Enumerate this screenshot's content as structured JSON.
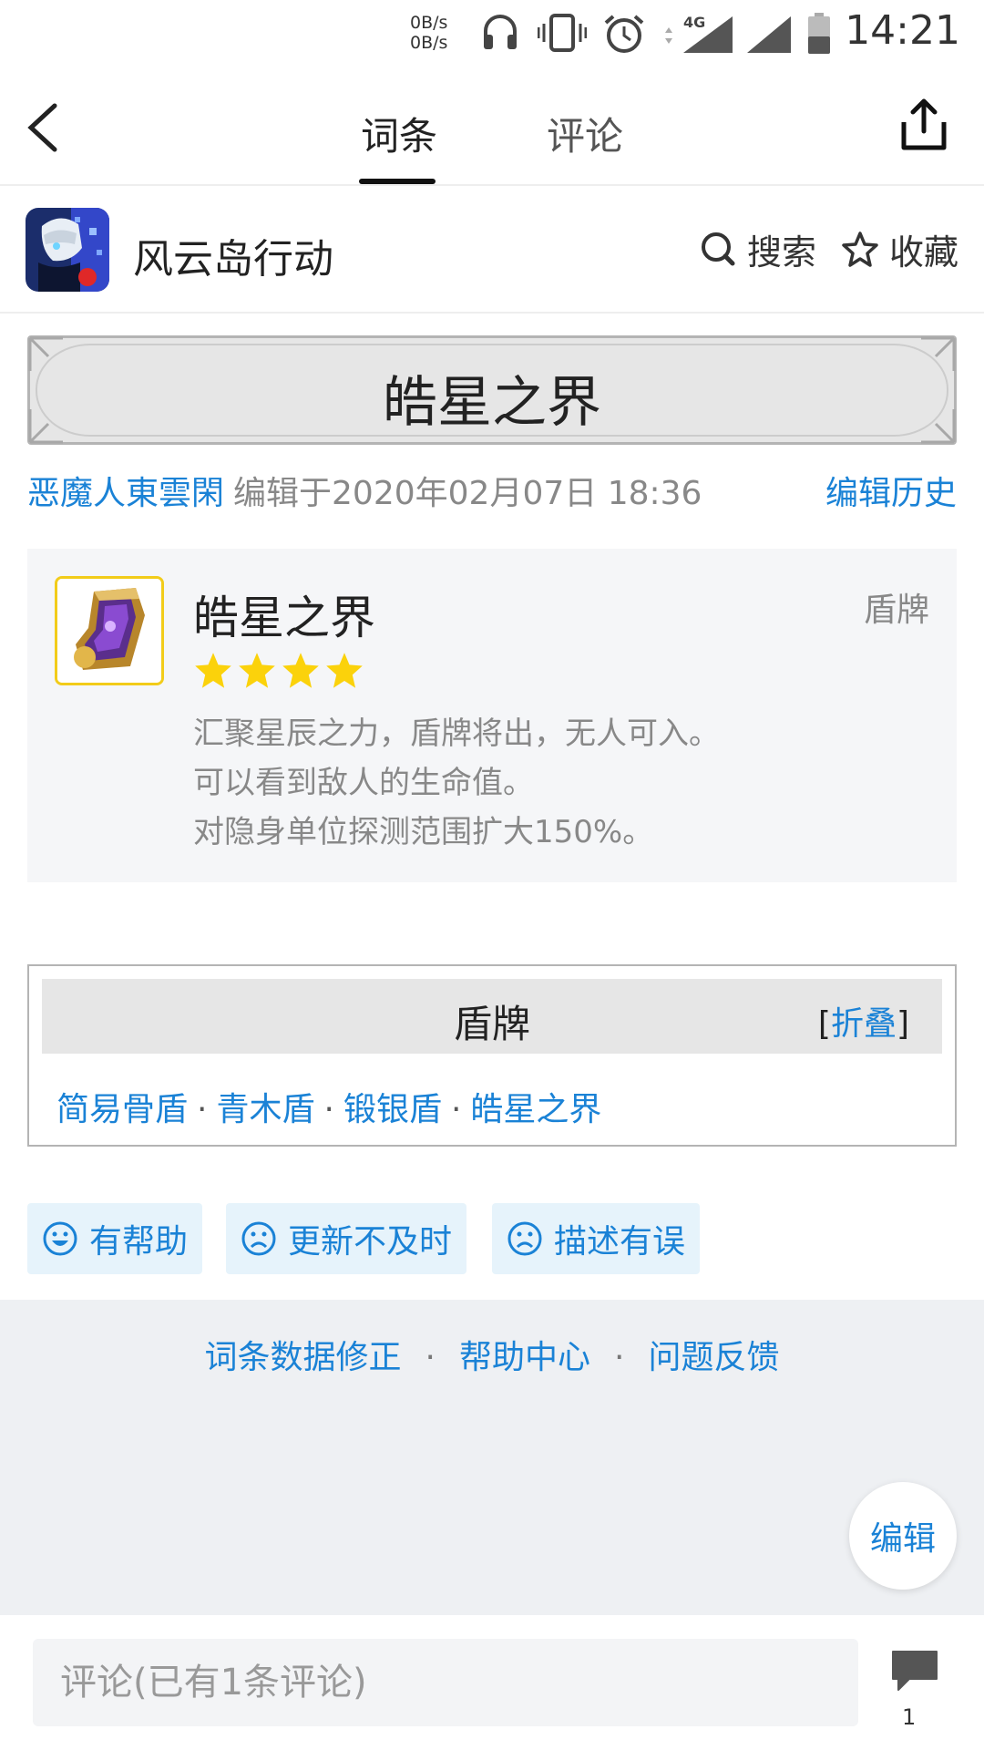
{
  "status_bar": {
    "net_speed_up": "0B/s",
    "net_speed_down": "0B/s",
    "network": "4G",
    "time": "14:21"
  },
  "nav": {
    "tabs": [
      {
        "label": "词条",
        "active": true
      },
      {
        "label": "评论",
        "active": false
      }
    ]
  },
  "app": {
    "name": "风云岛行动",
    "search_label": "搜索",
    "favorite_label": "收藏"
  },
  "entry": {
    "title": "皓星之界",
    "author": "恶魔人東雲閑",
    "edited": "编辑于2020年02月07日 18:36",
    "history_label": "编辑历史"
  },
  "item": {
    "name": "皓星之界",
    "type": "盾牌",
    "stars": 4,
    "description": [
      "汇聚星辰之力，盾牌将出，无人可入。",
      "可以看到敌人的生命值。",
      "对隐身单位探测范围扩大150%。"
    ]
  },
  "navbox": {
    "title": "盾牌",
    "collapse_open": "[",
    "collapse_label": "折叠",
    "collapse_close": "]",
    "links": [
      "简易骨盾",
      "青木盾",
      "锻银盾",
      "皓星之界"
    ],
    "separator": "·"
  },
  "feedback": {
    "helpful": "有帮助",
    "outdated": "更新不及时",
    "wrong": "描述有误"
  },
  "footer": {
    "links": [
      "词条数据修正",
      "帮助中心",
      "问题反馈"
    ],
    "separator": "·",
    "edit_label": "编辑"
  },
  "comment": {
    "placeholder": "评论(已有1条评论)",
    "count": "1"
  },
  "colors": {
    "accent": "#1a82d6",
    "star": "#fbd20b",
    "item_border": "#f2cc1a"
  }
}
